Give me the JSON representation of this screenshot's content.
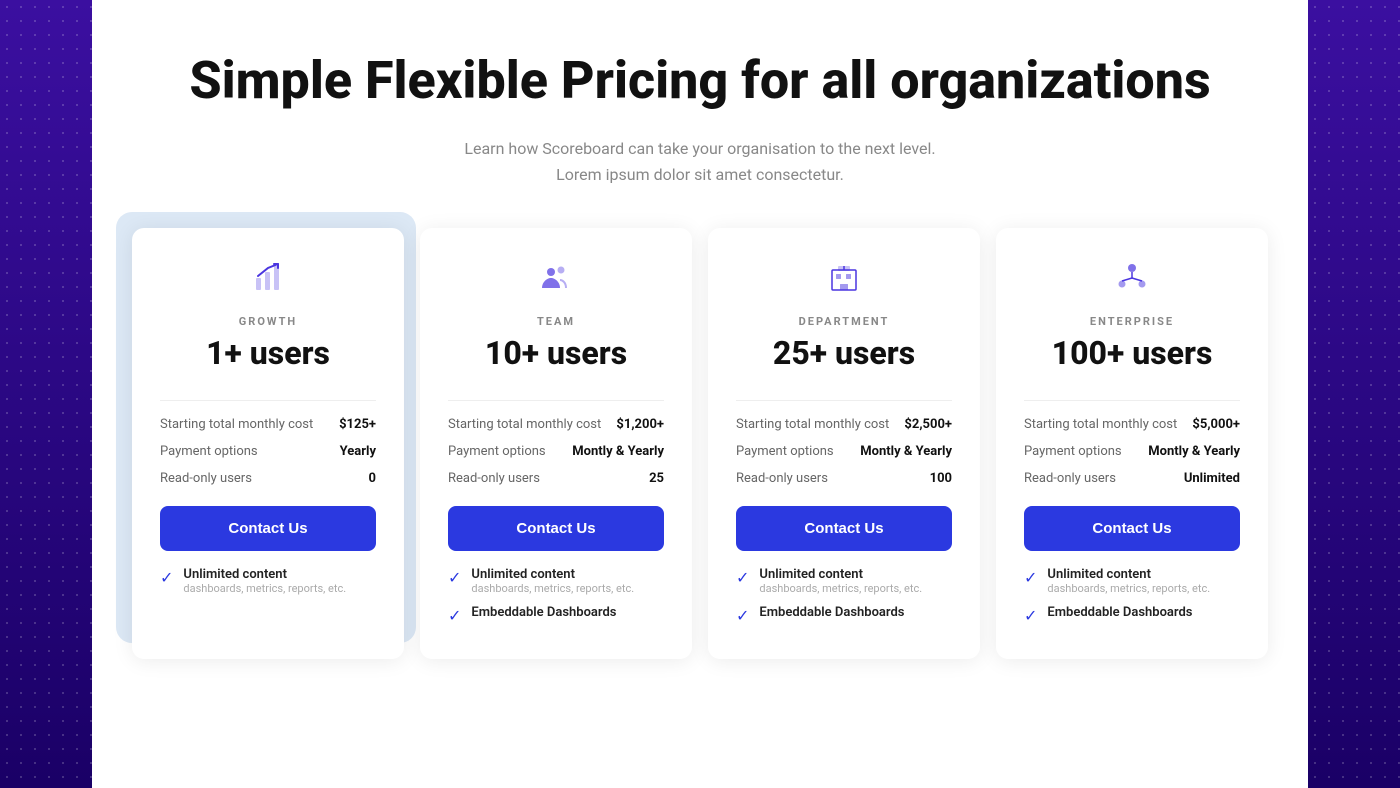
{
  "page": {
    "title": "Simple Flexible Pricing for all organizations",
    "subtitle": "Learn how Scoreboard can take your organisation to the next level. Lorem ipsum dolor sit amet consectetur."
  },
  "cards": [
    {
      "tier": "GROWTH",
      "users": "1+ users",
      "monthly_cost_label": "Starting total monthly cost",
      "monthly_cost_value": "$125+",
      "payment_label": "Payment options",
      "payment_value": "Yearly",
      "readonly_label": "Read-only users",
      "readonly_value": "0",
      "cta": "Contact Us",
      "features": [
        {
          "title": "Unlimited content",
          "subtitle": "dashboards, metrics, reports, etc."
        }
      ]
    },
    {
      "tier": "TEAM",
      "users": "10+ users",
      "monthly_cost_label": "Starting total monthly cost",
      "monthly_cost_value": "$1,200+",
      "payment_label": "Payment options",
      "payment_value": "Montly & Yearly",
      "readonly_label": "Read-only users",
      "readonly_value": "25",
      "cta": "Contact Us",
      "features": [
        {
          "title": "Unlimited content",
          "subtitle": "dashboards, metrics, reports, etc."
        },
        {
          "title": "Embeddable Dashboards",
          "subtitle": ""
        }
      ]
    },
    {
      "tier": "DEPARTMENT",
      "users": "25+ users",
      "monthly_cost_label": "Starting total monthly cost",
      "monthly_cost_value": "$2,500+",
      "payment_label": "Payment options",
      "payment_value": "Montly & Yearly",
      "readonly_label": "Read-only users",
      "readonly_value": "100",
      "cta": "Contact Us",
      "features": [
        {
          "title": "Unlimited content",
          "subtitle": "dashboards, metrics, reports, etc."
        },
        {
          "title": "Embeddable Dashboards",
          "subtitle": ""
        }
      ]
    },
    {
      "tier": "ENTERPRISE",
      "users": "100+ users",
      "monthly_cost_label": "Starting total monthly cost",
      "monthly_cost_value": "$5,000+",
      "payment_label": "Payment options",
      "payment_value": "Montly & Yearly",
      "readonly_label": "Read-only users",
      "readonly_value": "Unlimited",
      "cta": "Contact Us",
      "features": [
        {
          "title": "Unlimited content",
          "subtitle": "dashboards, metrics, reports, etc."
        },
        {
          "title": "Embeddable Dashboards",
          "subtitle": ""
        }
      ]
    }
  ]
}
